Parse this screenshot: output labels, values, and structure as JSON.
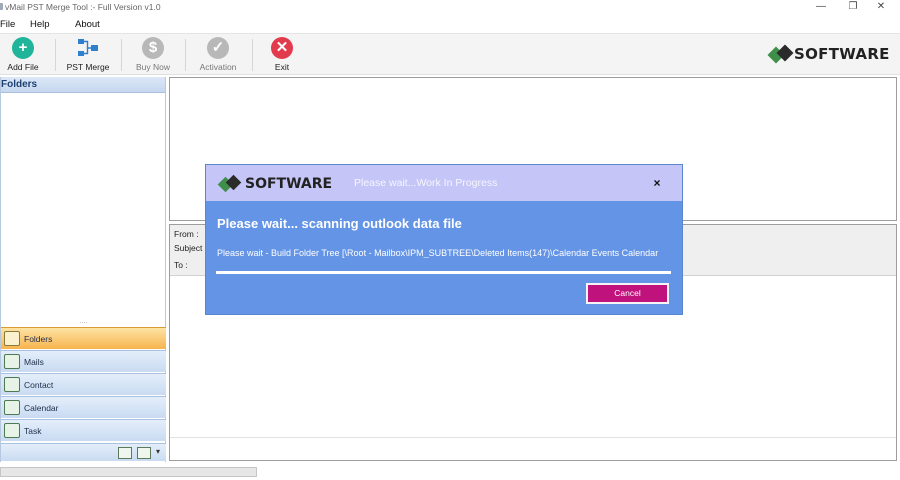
{
  "window": {
    "title": "vMail PST Merge Tool :- Full Version v1.0",
    "minimize_glyph": "—",
    "maximize_glyph": "❐",
    "close_glyph": "✕"
  },
  "menu": [
    "File",
    "Help",
    "About"
  ],
  "toolbar": {
    "add_file": "Add File",
    "pst_merge": "PST Merge",
    "buy_now": "Buy Now",
    "activation": "Activation",
    "exit": "Exit",
    "add_glyph": "+",
    "buy_glyph": "$",
    "activation_glyph": "✓",
    "exit_glyph": "✕",
    "colors": {
      "add": "#20b59a",
      "buy": "#b8b8b8",
      "activation": "#b8b8b8",
      "exit": "#e23b4e"
    }
  },
  "brand": "SOFTWARE",
  "left_panel": {
    "header": "Folders",
    "splitter_grip": "....",
    "nav": [
      "Folders",
      "Mails",
      "Contact",
      "Calendar",
      "Task"
    ],
    "active": "Folders"
  },
  "preview": {
    "from_label": "From :",
    "subject_label": "Subject :",
    "to_label": "To :"
  },
  "dialog": {
    "brand": "SOFTWARE",
    "subtitle": "Please wait...Work In Progress",
    "close_glyph": "×",
    "title": "Please wait... scanning outlook data file",
    "status": "Please wait - Build Folder Tree [\\Root - Mailbox\\IPM_SUBTREE\\Deleted Items(147)\\Calendar Events Calendar",
    "progress_percent": 100,
    "cancel": "Cancel",
    "colors": {
      "header": "#c5c5f7",
      "body": "#6494e6",
      "cancel": "#c0127c"
    }
  }
}
